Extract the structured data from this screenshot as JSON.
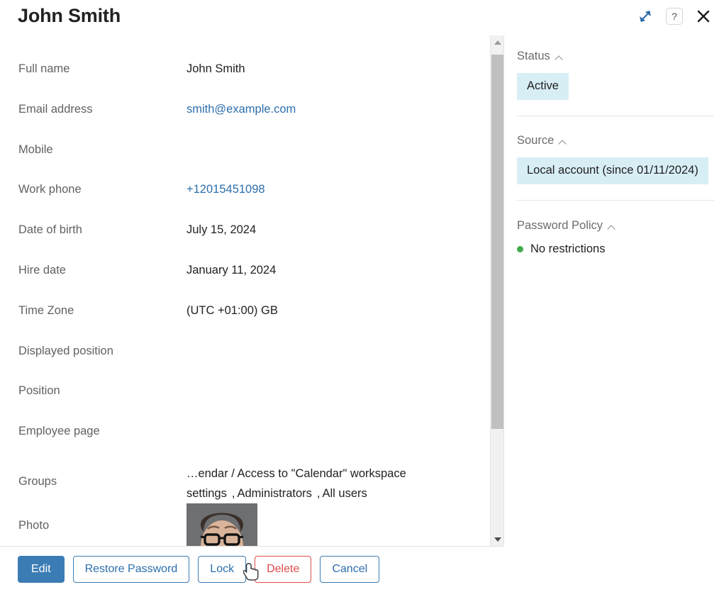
{
  "header": {
    "title": "John Smith",
    "expand_icon": "expand-diagonal-icon",
    "help_icon": "question-mark-icon",
    "help_label": "?",
    "close_icon": "close-x-icon"
  },
  "form": {
    "rows": [
      {
        "label": "Full name",
        "value": "John Smith",
        "type": "text"
      },
      {
        "label": "Email address",
        "value": "smith@example.com",
        "type": "link"
      },
      {
        "label": "Mobile",
        "value": "",
        "type": "text"
      },
      {
        "label": "Work phone",
        "value": "+12015451098",
        "type": "link"
      },
      {
        "label": "Date of birth",
        "value": "July 15, 2024",
        "type": "text"
      },
      {
        "label": "Hire date",
        "value": "January 11, 2024",
        "type": "text"
      },
      {
        "label": "Time Zone",
        "value": "(UTC +01:00) GB",
        "type": "text"
      },
      {
        "label": "Displayed position",
        "value": "",
        "type": "text"
      },
      {
        "label": "Position",
        "value": "",
        "type": "text"
      },
      {
        "label": "Employee page",
        "value": "",
        "type": "text"
      }
    ],
    "groups": {
      "label": "Groups",
      "items": [
        {
          "text": "…endar / Access to \"Calendar\" workspace settings",
          "link": true
        },
        {
          "text": "Administrators",
          "link": true
        },
        {
          "text": "All users",
          "link": false
        }
      ],
      "separator": ","
    },
    "photo": {
      "label": "Photo",
      "alt": "user-photo-man-with-glasses"
    }
  },
  "scrollbar": {
    "up_icon": "caret-up-icon",
    "down_icon": "caret-down-icon"
  },
  "sidebar": {
    "sections": [
      {
        "title": "Status",
        "collapse_icon": "chevron-up-icon",
        "value": "Active"
      },
      {
        "title": "Source",
        "collapse_icon": "chevron-up-icon",
        "value": "Local account (since 01/11/2024)"
      },
      {
        "title": "Password Policy",
        "collapse_icon": "chevron-up-icon",
        "value": "No restrictions",
        "status_color": "#43aa4e"
      }
    ]
  },
  "footer": {
    "buttons": [
      {
        "label": "Edit",
        "style": "primary"
      },
      {
        "label": "Restore Password",
        "style": "default"
      },
      {
        "label": "Lock",
        "style": "default"
      },
      {
        "label": "Delete",
        "style": "danger"
      },
      {
        "label": "Cancel",
        "style": "default"
      }
    ]
  },
  "colors": {
    "accent": "#2c6ead",
    "primary_button": "#3b7cb5",
    "danger": "#e24a4a",
    "pill_background": "#d8eef5",
    "status_green": "#43aa4e",
    "label_gray": "#616161"
  }
}
